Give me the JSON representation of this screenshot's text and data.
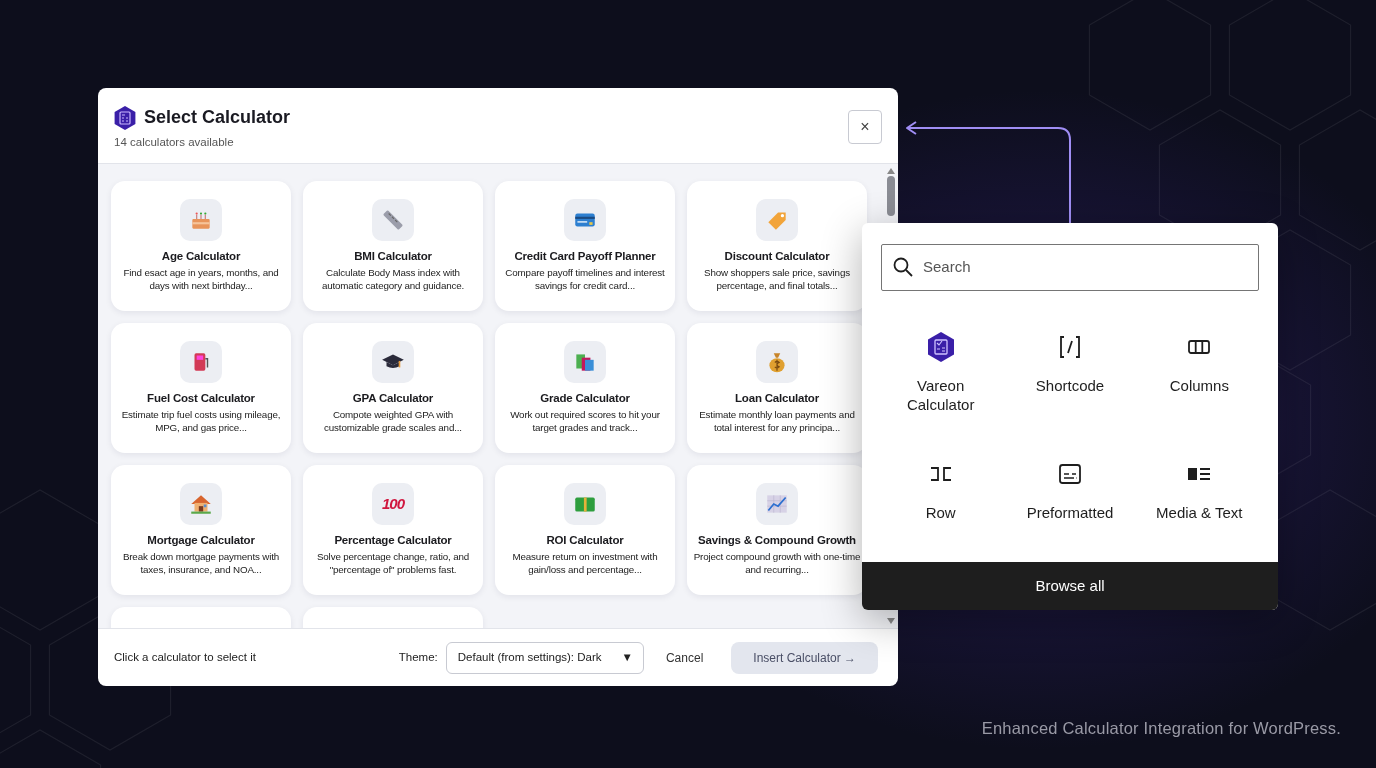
{
  "dialog": {
    "title": "Select Calculator",
    "subtitle": "14 calculators available",
    "close": "×",
    "calculators": [
      {
        "title": "Age Calculator",
        "description": "Find esact age in years, months, and days with next birthday..."
      },
      {
        "title": "BMI Calculator",
        "description": "Calculate Body Mass index with automatic category and guidance."
      },
      {
        "title": "Credit Card Payoff Planner",
        "description": "Compare payoff timelines and interest savings for credit card..."
      },
      {
        "title": "Discount Calculator",
        "description": "Show shoppers sale price, savings percentage, and final totals..."
      },
      {
        "title": "Fuel Cost Calculator",
        "description": "Estimate trip fuel costs using mileage, MPG, and gas price..."
      },
      {
        "title": "GPA Calculator",
        "description": "Compote weighted GPA with customizable grade scales and..."
      },
      {
        "title": "Grade Calculator",
        "description": "Work out required scores to hit your target grades and track..."
      },
      {
        "title": "Loan Calculator",
        "description": "Estimate monthly loan payments and total interest for any principa..."
      },
      {
        "title": "Mortgage Calculator",
        "description": "Break down mortgage payments with taxes, insurance, and NOA..."
      },
      {
        "title": "Percentage Calculator",
        "description": "Solve percentage change, ratio, and \"percentage of\" problems fast.",
        "icon_text": "100"
      },
      {
        "title": "ROI Calculator",
        "description": "Measure retum on investment with gain/loss and percentage..."
      },
      {
        "title": "Savings & Compound Growth",
        "description": "Project compound growth with one-time and recurring..."
      }
    ],
    "footer": {
      "hint": "Click a calculator to select it",
      "theme_label": "Theme:",
      "theme_value": "Default (from settings): Dark",
      "theme_caret": "▼",
      "cancel": "Cancel",
      "insert": {
        "label": "Insert Calculator →",
        "disabled": true
      }
    }
  },
  "inserter": {
    "search": {
      "placeholder": "Search"
    },
    "blocks": [
      {
        "label": "Vareon Calculator"
      },
      {
        "label": "Shortcode"
      },
      {
        "label": "Columns"
      },
      {
        "label": "Row"
      },
      {
        "label": "Preformatted"
      },
      {
        "label": "Media & Text"
      }
    ],
    "browse_all": "Browse all"
  },
  "caption": "Enhanced Calculator Integration for WordPress."
}
